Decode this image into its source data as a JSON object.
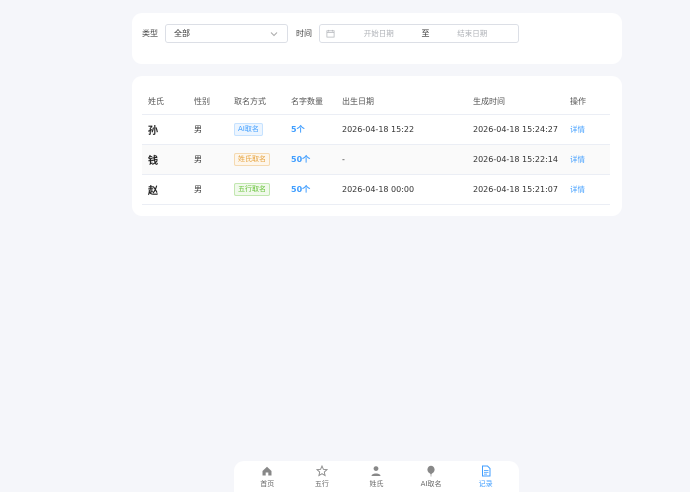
{
  "filter": {
    "type_label": "类型",
    "type_value": "全部",
    "time_label": "时间",
    "start_placeholder": "开始日期",
    "range_separator": "至",
    "end_placeholder": "结束日期"
  },
  "table": {
    "headers": [
      "姓氏",
      "性别",
      "取名方式",
      "名字数量",
      "出生日期",
      "生成时间",
      "操作"
    ],
    "rows": [
      {
        "surname": "孙",
        "gender": "男",
        "method": "AI取名",
        "method_kind": "ai",
        "count": "5个",
        "birth": "2026-04-18 15:22",
        "created": "2026-04-18 15:24:27",
        "action": "详情"
      },
      {
        "surname": "钱",
        "gender": "男",
        "method": "姓氏取名",
        "method_kind": "surname",
        "count": "50个",
        "birth": "-",
        "created": "2026-04-18 15:22:14",
        "action": "详情"
      },
      {
        "surname": "赵",
        "gender": "男",
        "method": "五行取名",
        "method_kind": "wuxing",
        "count": "50个",
        "birth": "2026-04-18 00:00",
        "created": "2026-04-18 15:21:07",
        "action": "详情"
      }
    ]
  },
  "nav": {
    "items": [
      {
        "label": "首页",
        "icon": "home-icon"
      },
      {
        "label": "五行",
        "icon": "star-icon"
      },
      {
        "label": "姓氏",
        "icon": "user-icon"
      },
      {
        "label": "AI取名",
        "icon": "balloon-icon"
      },
      {
        "label": "记录",
        "icon": "document-icon",
        "active": true
      }
    ]
  },
  "colors": {
    "accent": "#409eff",
    "background": "#f5f6fa",
    "nav_inactive": "#888888"
  }
}
